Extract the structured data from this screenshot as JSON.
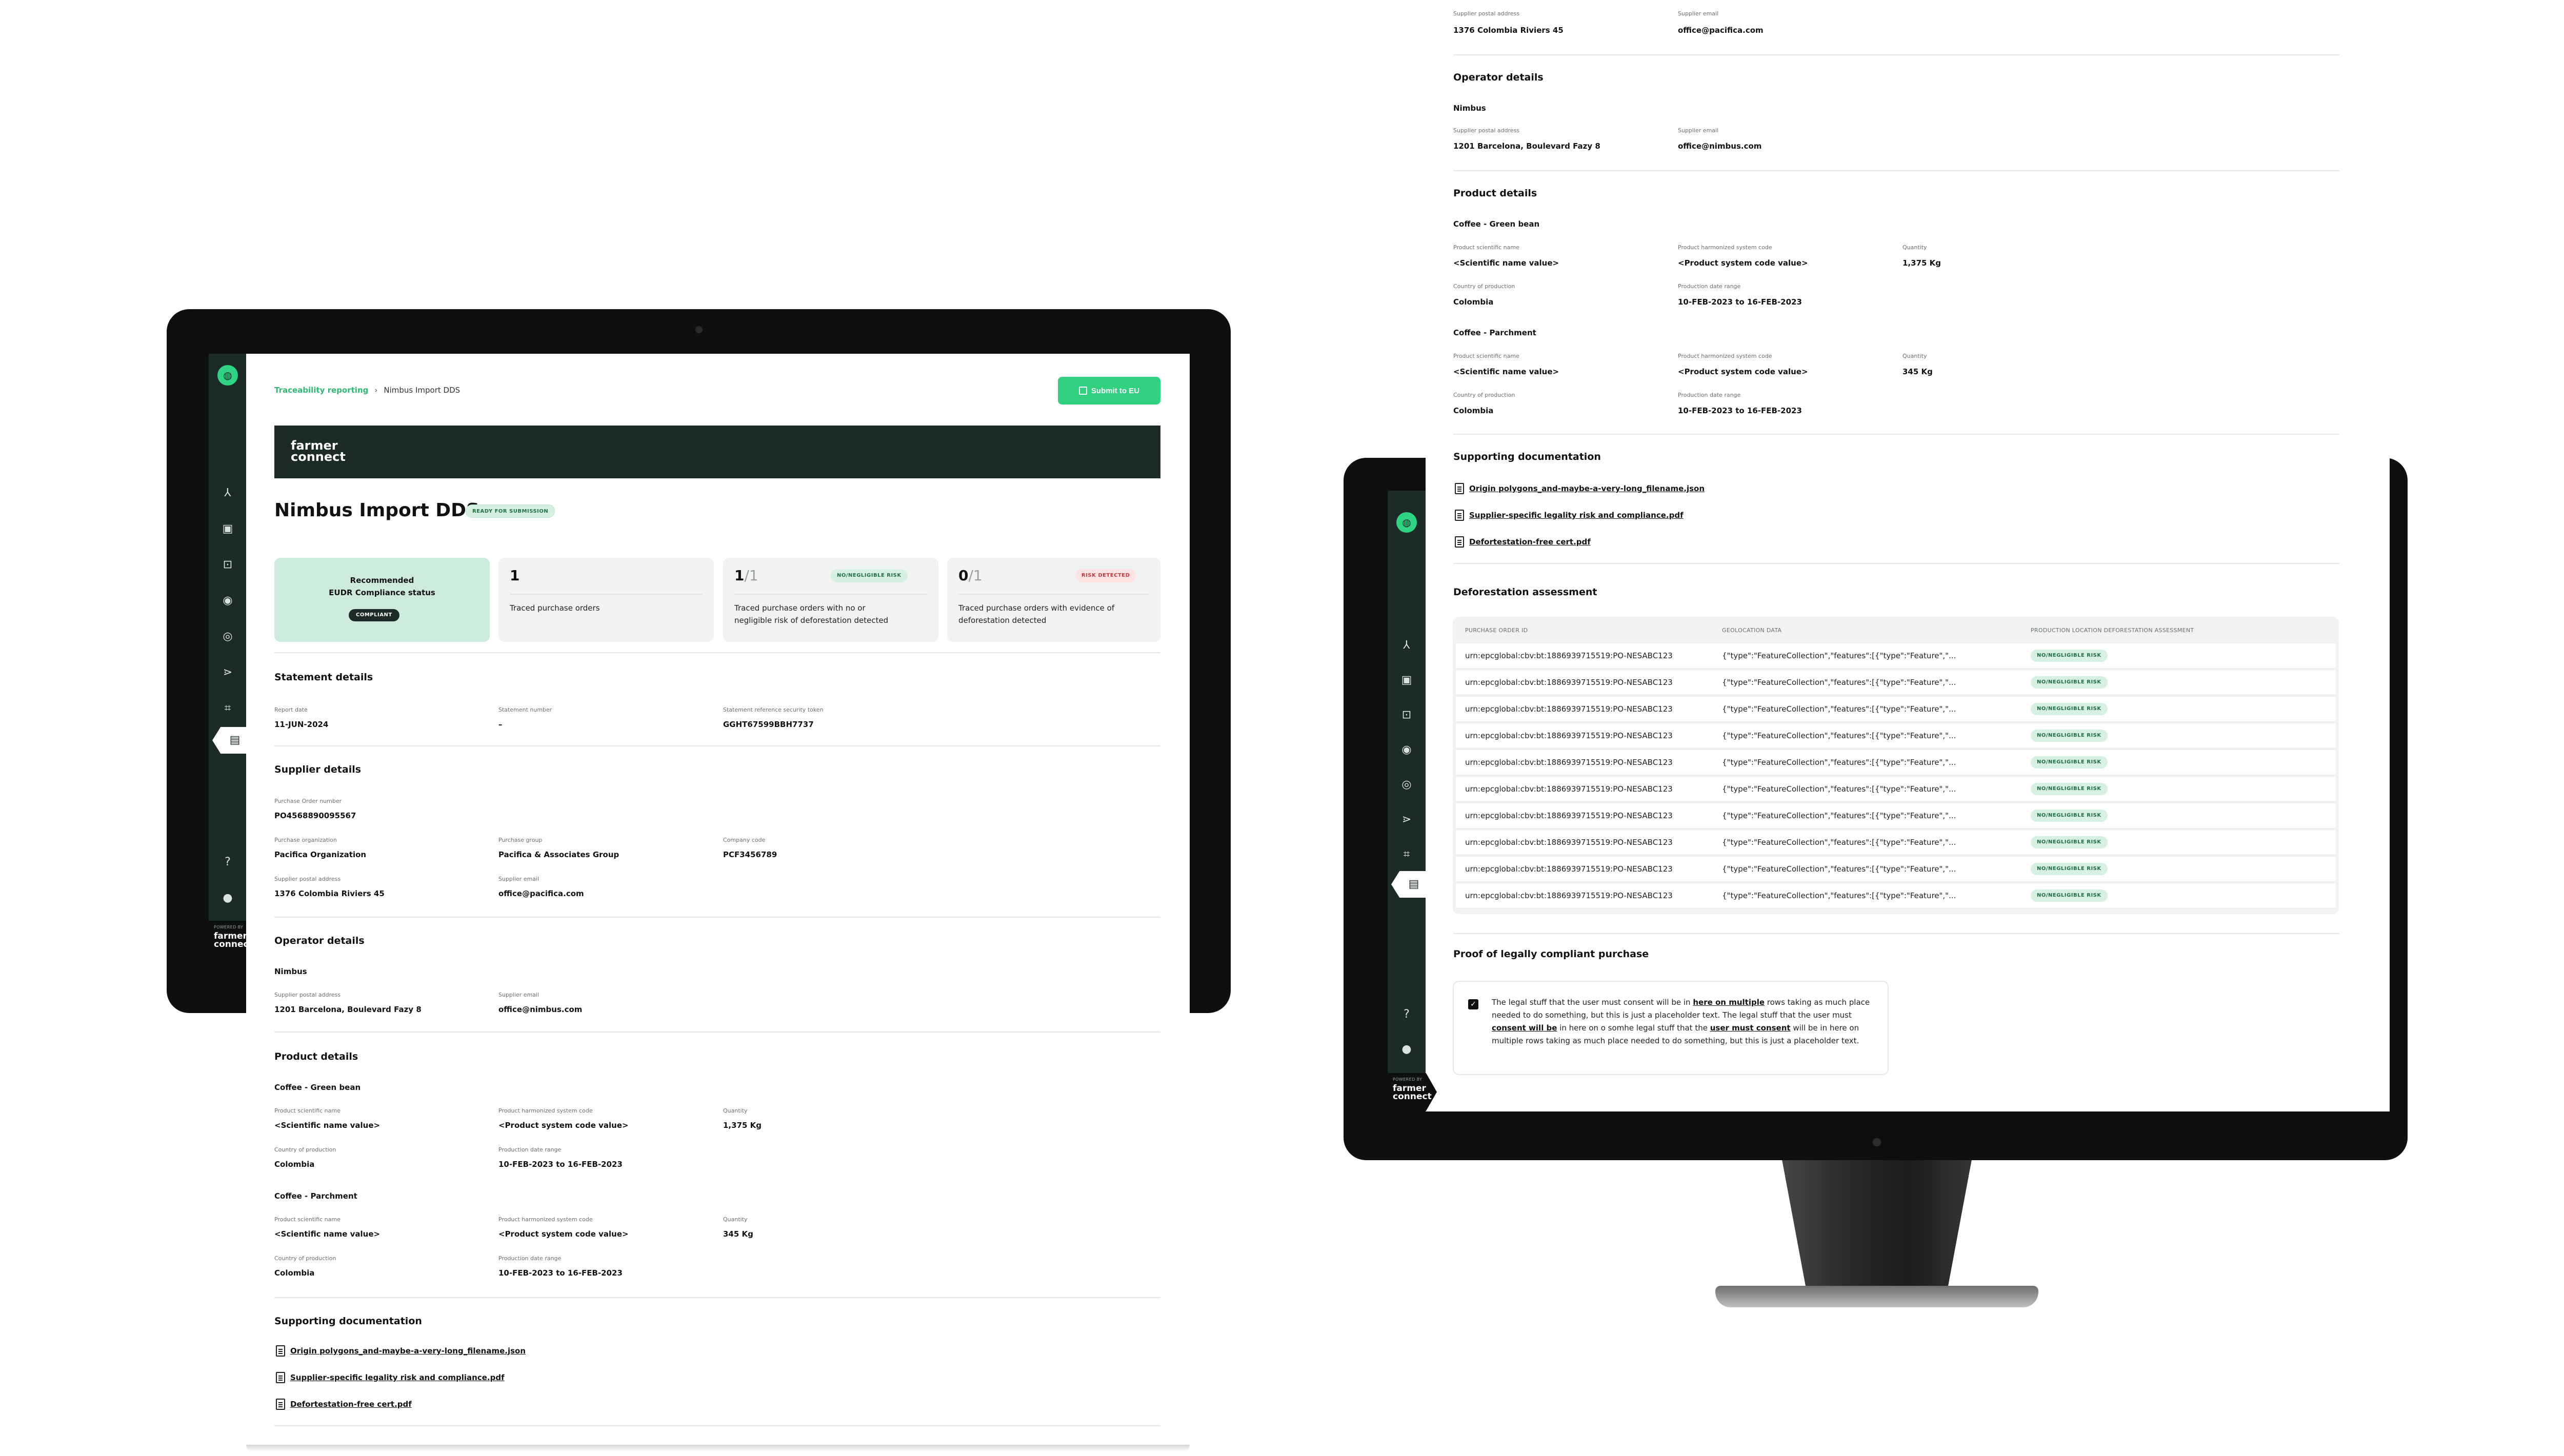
{
  "brand": {
    "name_line1": "farmer",
    "name_line2": "connect",
    "powered": "POWERED BY",
    "accent": "#32d081",
    "dark": "#1c2b27"
  },
  "breadcrumb": {
    "parent": "Traceability reporting",
    "current": "Nimbus Import DDS"
  },
  "actions": {
    "submit": "Submit to EU"
  },
  "page": {
    "title": "Nimbus Import DDS",
    "status_badge": "READY FOR SUBMISSION"
  },
  "summary": {
    "recommended_line1": "Recommended",
    "recommended_line2": "EUDR Compliance status",
    "compliant": "COMPLIANT",
    "traced_count": "1",
    "traced_label": "Traced purchase orders",
    "negligible_num": "1",
    "negligible_den": "/1",
    "negligible_badge": "NO/NEGLIGIBLE RISK",
    "negligible_label_1": "Traced purchase orders with no or",
    "negligible_label_2": "negligible risk of deforestation detected",
    "risk_num": "0",
    "risk_den": "/1",
    "risk_badge": "RISK DETECTED",
    "risk_label_1": "Traced purchase orders with evidence of",
    "risk_label_2": "deforestation detected"
  },
  "statement": {
    "title": "Statement details",
    "report_date_label": "Report date",
    "report_date": "11-JUN-2024",
    "number_label": "Statement number",
    "number": "–",
    "token_label": "Statement reference security token",
    "token": "GGHT67599BBH7737"
  },
  "supplier": {
    "title": "Supplier details",
    "po_label": "Purchase Order number",
    "po": "PO4568890095567",
    "org_label": "Purchase organization",
    "org": "Pacifica Organization",
    "group_label": "Purchase group",
    "group": "Pacifica & Associates Group",
    "code_label": "Company code",
    "code": "PCF3456789",
    "address_label": "Supplier postal address",
    "address": "1376 Colombia Riviers 45",
    "email_label": "Supplier email",
    "email": "office@pacifica.com"
  },
  "operator": {
    "title": "Operator details",
    "name": "Nimbus",
    "address_label": "Supplier postal address",
    "address": "1201 Barcelona, Boulevard Fazy 8",
    "email_label": "Supplier email",
    "email": "office@nimbus.com"
  },
  "products": {
    "title": "Product details",
    "sci_label": "Product scientific name",
    "hs_label": "Product harmonized system code",
    "qty_label": "Quantity",
    "country_label": "Country of production",
    "range_label": "Production date range",
    "items": [
      {
        "name": "Coffee - Green bean",
        "sci": "<Scientific name value>",
        "hs": "<Product system code value>",
        "qty": "1,375 Kg",
        "country": "Colombia",
        "range": "10-FEB-2023 to 16-FEB-2023"
      },
      {
        "name": "Coffee - Parchment",
        "sci": "<Scientific name value>",
        "hs": "<Product system code value>",
        "qty": "345 Kg",
        "country": "Colombia",
        "range": "10-FEB-2023 to 16-FEB-2023"
      }
    ]
  },
  "docs": {
    "title": "Supporting documentation",
    "files": [
      "Origin polygons_and-maybe-a-very-long_filename.json",
      "Supplier-specific legality risk and compliance.pdf",
      "Defortestation-free cert.pdf"
    ]
  },
  "assessment": {
    "title": "Deforestation assessment",
    "col_po": "PURCHASE ORDER ID",
    "col_geo": "GEOLOCATION DATA",
    "col_risk": "PRODUCTION LOCATION DEFORESTATION ASSESSMENT",
    "rows": [
      {
        "po": "urn:epcglobal:cbv:bt:1886939715519:PO-NESABC123",
        "geo": "{\"type\":\"FeatureCollection\",\"features\":[{\"type\":\"Feature\",\"...",
        "risk": "NO/NEGLIGIBLE RISK"
      },
      {
        "po": "urn:epcglobal:cbv:bt:1886939715519:PO-NESABC123",
        "geo": "{\"type\":\"FeatureCollection\",\"features\":[{\"type\":\"Feature\",\"...",
        "risk": "NO/NEGLIGIBLE RISK"
      },
      {
        "po": "urn:epcglobal:cbv:bt:1886939715519:PO-NESABC123",
        "geo": "{\"type\":\"FeatureCollection\",\"features\":[{\"type\":\"Feature\",\"...",
        "risk": "NO/NEGLIGIBLE RISK"
      },
      {
        "po": "urn:epcglobal:cbv:bt:1886939715519:PO-NESABC123",
        "geo": "{\"type\":\"FeatureCollection\",\"features\":[{\"type\":\"Feature\",\"...",
        "risk": "NO/NEGLIGIBLE RISK"
      },
      {
        "po": "urn:epcglobal:cbv:bt:1886939715519:PO-NESABC123",
        "geo": "{\"type\":\"FeatureCollection\",\"features\":[{\"type\":\"Feature\",\"...",
        "risk": "NO/NEGLIGIBLE RISK"
      },
      {
        "po": "urn:epcglobal:cbv:bt:1886939715519:PO-NESABC123",
        "geo": "{\"type\":\"FeatureCollection\",\"features\":[{\"type\":\"Feature\",\"...",
        "risk": "NO/NEGLIGIBLE RISK"
      },
      {
        "po": "urn:epcglobal:cbv:bt:1886939715519:PO-NESABC123",
        "geo": "{\"type\":\"FeatureCollection\",\"features\":[{\"type\":\"Feature\",\"...",
        "risk": "NO/NEGLIGIBLE RISK"
      },
      {
        "po": "urn:epcglobal:cbv:bt:1886939715519:PO-NESABC123",
        "geo": "{\"type\":\"FeatureCollection\",\"features\":[{\"type\":\"Feature\",\"...",
        "risk": "NO/NEGLIGIBLE RISK"
      },
      {
        "po": "urn:epcglobal:cbv:bt:1886939715519:PO-NESABC123",
        "geo": "{\"type\":\"FeatureCollection\",\"features\":[{\"type\":\"Feature\",\"...",
        "risk": "NO/NEGLIGIBLE RISK"
      },
      {
        "po": "urn:epcglobal:cbv:bt:1886939715519:PO-NESABC123",
        "geo": "{\"type\":\"FeatureCollection\",\"features\":[{\"type\":\"Feature\",\"...",
        "risk": "NO/NEGLIGIBLE RISK"
      }
    ]
  },
  "proof": {
    "title": "Proof of legally compliant purchase",
    "t1": "The legal stuff that the user must consent will be in ",
    "l1": "here on multiple",
    "t2": " rows taking as much place needed to do something, but this is just a placeholder text. The legal stuff that the user must ",
    "l2": "consent will be",
    "t3": " in here on o somhe legal stuff that the ",
    "l3": "user must consent",
    "t4": " will be in here on multiple rows taking as much place needed to do something, but this is just a placeholder text."
  },
  "icons": {
    "nav": [
      "hierarchy-icon",
      "folder-icon",
      "inbox-icon",
      "location-pin-icon",
      "location-pin-icon",
      "share-icon",
      "scan-icon",
      "report-icon",
      "help-icon",
      "profile-icon"
    ]
  }
}
